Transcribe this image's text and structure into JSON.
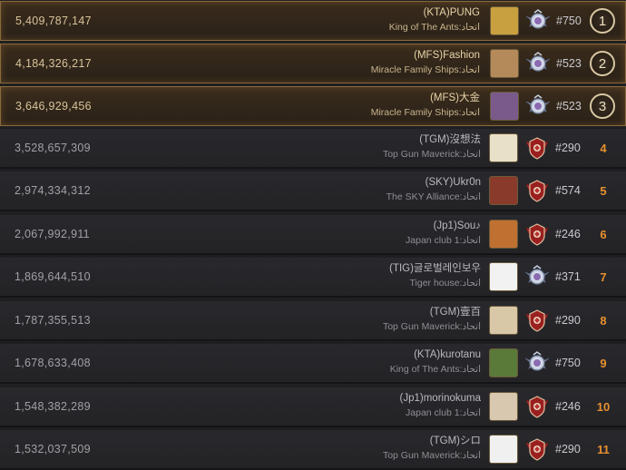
{
  "leaderboard": {
    "rows": [
      {
        "score": "5,409,787,147",
        "name": "(KTA)PUNG",
        "guild": "King of The Ants:اتحاد",
        "level": "#750",
        "rank": "1",
        "top": true,
        "avatar_color": "#c8a040",
        "badge": "silver-wing-badge"
      },
      {
        "score": "4,184,326,217",
        "name": "(MFS)Fashion",
        "guild": "Miracle Family Ships:اتحاد",
        "level": "#523",
        "rank": "2",
        "top": true,
        "avatar_color": "#b58a5a",
        "badge": "silver-wing-badge"
      },
      {
        "score": "3,646,929,456",
        "name": "(MFS)大金",
        "guild": "Miracle Family Ships:اتحاد",
        "level": "#523",
        "rank": "3",
        "top": true,
        "avatar_color": "#7a5a8a",
        "badge": "silver-wing-badge"
      },
      {
        "score": "3,528,657,309",
        "name": "(TGM)沒想法",
        "guild": "Top Gun Maverick:اتحاد",
        "level": "#290",
        "rank": "4",
        "top": false,
        "avatar_color": "#e8e0c8",
        "badge": "red-shield-badge"
      },
      {
        "score": "2,974,334,312",
        "name": "(SKY)Ukr0n",
        "guild": "The SKY Alliance:اتحاد",
        "level": "#574",
        "rank": "5",
        "top": false,
        "avatar_color": "#8a3a2a",
        "badge": "red-shield-badge"
      },
      {
        "score": "2,067,992,911",
        "name": "(Jp1)Sou♪",
        "guild": "Japan club 1:اتحاد",
        "level": "#246",
        "rank": "6",
        "top": false,
        "avatar_color": "#c07030",
        "badge": "red-shield-badge"
      },
      {
        "score": "1,869,644,510",
        "name": "(TIG)글로벌레인보우",
        "guild": "Tiger house:اتحاد",
        "level": "#371",
        "rank": "7",
        "top": false,
        "avatar_color": "#f2f2f2",
        "badge": "silver-wing-badge"
      },
      {
        "score": "1,787,355,513",
        "name": "(TGM)壹百",
        "guild": "Top Gun Maverick:اتحاد",
        "level": "#290",
        "rank": "8",
        "top": false,
        "avatar_color": "#d8c8a8",
        "badge": "red-shield-badge"
      },
      {
        "score": "1,678,633,408",
        "name": "(KTA)kurotanu",
        "guild": "King of The Ants:اتحاد",
        "level": "#750",
        "rank": "9",
        "top": false,
        "avatar_color": "#5a7a3a",
        "badge": "silver-wing-badge"
      },
      {
        "score": "1,548,382,289",
        "name": "(Jp1)morinokuma",
        "guild": "Japan club 1:اتحاد",
        "level": "#246",
        "rank": "10",
        "top": false,
        "avatar_color": "#d8c8b0",
        "badge": "red-shield-badge"
      },
      {
        "score": "1,532,037,509",
        "name": "(TGM)シロ",
        "guild": "Top Gun Maverick:اتحاد",
        "level": "#290",
        "rank": "11",
        "top": false,
        "avatar_color": "#f0f0f0",
        "badge": "red-shield-badge"
      }
    ]
  }
}
